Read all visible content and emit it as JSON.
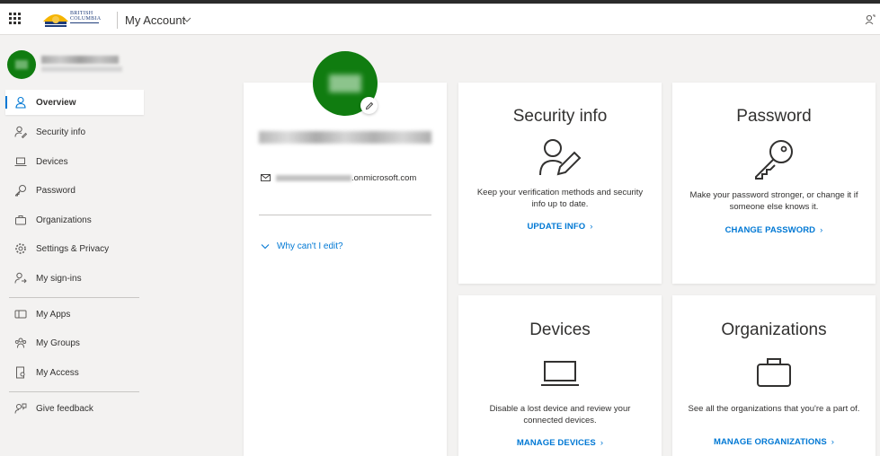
{
  "header": {
    "app_title": "My Account",
    "logo_line1": "BRITISH",
    "logo_line2": "COLUMBIA"
  },
  "sidebar": {
    "items": [
      {
        "label": "Overview",
        "icon": "person-icon",
        "active": true
      },
      {
        "label": "Security info",
        "icon": "person-key-icon"
      },
      {
        "label": "Devices",
        "icon": "laptop-icon"
      },
      {
        "label": "Password",
        "icon": "key-icon"
      },
      {
        "label": "Organizations",
        "icon": "briefcase-icon"
      },
      {
        "label": "Settings & Privacy",
        "icon": "gear-icon"
      },
      {
        "label": "My sign-ins",
        "icon": "person-signin-icon"
      },
      {
        "label": "My Apps",
        "icon": "apps-icon"
      },
      {
        "label": "My Groups",
        "icon": "groups-icon"
      },
      {
        "label": "My Access",
        "icon": "access-icon"
      },
      {
        "label": "Give feedback",
        "icon": "feedback-icon"
      }
    ]
  },
  "profile": {
    "email_suffix": "onmicrosoft.com",
    "why_edit": "Why can't I edit?"
  },
  "tiles": {
    "security": {
      "title": "Security info",
      "description": "Keep your verification methods and security info up to date.",
      "link": "UPDATE INFO"
    },
    "password": {
      "title": "Password",
      "description": "Make your password stronger, or change it if someone else knows it.",
      "link": "CHANGE PASSWORD"
    },
    "devices": {
      "title": "Devices",
      "description": "Disable a lost device and review your connected devices.",
      "link": "MANAGE DEVICES"
    },
    "organizations": {
      "title": "Organizations",
      "description": "See all the organizations that you're a part of.",
      "link": "MANAGE ORGANIZATIONS"
    }
  },
  "colors": {
    "accent": "#0078d4",
    "avatar": "#107c10",
    "background": "#f3f2f1"
  }
}
